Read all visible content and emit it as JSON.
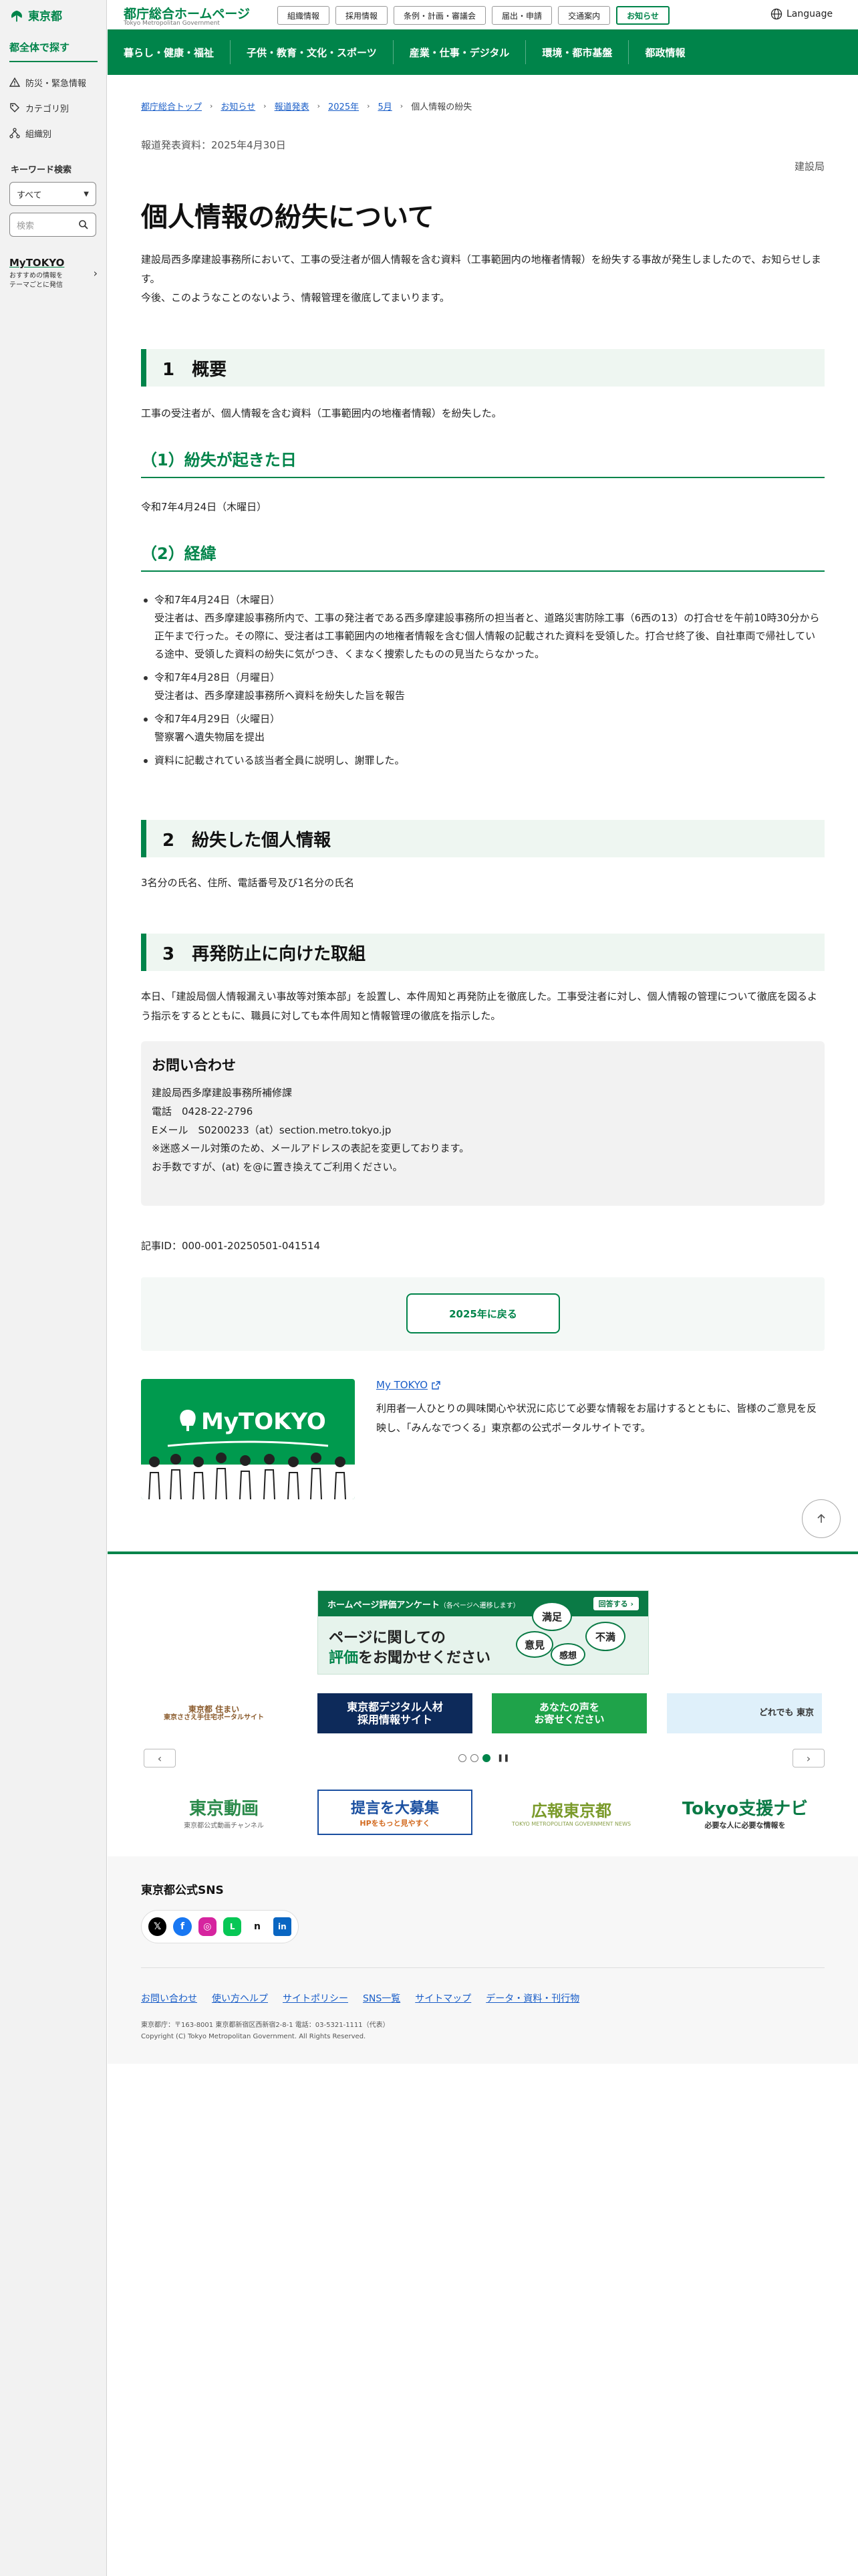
{
  "sidebar": {
    "logo_text": "東京都",
    "title": "都全体で探す",
    "items": [
      {
        "label": "防災・緊急情報",
        "icon": "warning-icon"
      },
      {
        "label": "カテゴリ別",
        "icon": "tag-icon"
      },
      {
        "label": "組織別",
        "icon": "org-chart-icon"
      }
    ],
    "keyword_title": "キーワード検索",
    "select_value": "すべて",
    "search_placeholder": "検索",
    "mytokyo": {
      "logo": "MyTOKYO",
      "desc": "おすすめの情報を\nテーマごとに発信"
    }
  },
  "header": {
    "site_name": "都庁総合ホームページ",
    "site_sub": "Tokyo Metropolitan Government",
    "links": [
      "組織情報",
      "採用情報",
      "条例・計画・審議会",
      "届出・申請",
      "交通案内",
      "お知らせ"
    ],
    "active_link": "お知らせ",
    "language": "Language"
  },
  "nav": [
    "暮らし・健康・福祉",
    "子供・教育・文化・スポーツ",
    "産業・仕事・デジタル",
    "環境・都市基盤",
    "都政情報"
  ],
  "breadcrumb": {
    "links": [
      "都庁総合トップ",
      "お知らせ",
      "報道発表",
      "2025年",
      "5月"
    ],
    "current": "個人情報の紛失"
  },
  "article": {
    "pubdate": "報道発表資料：2025年4月30日",
    "bureau": "建設局",
    "title": "個人情報の紛失について",
    "lead": [
      "建設局西多摩建設事務所において、工事の受注者が個人情報を含む資料（工事範囲内の地権者情報）を紛失する事故が発生しましたので、お知らせします。",
      "今後、このようなことのないよう、情報管理を徹底してまいります。"
    ],
    "sec1": {
      "heading": "1　概要",
      "body": "工事の受注者が、個人情報を含む資料（工事範囲内の地権者情報）を紛失した。",
      "sub1_heading": "（1）紛失が起きた日",
      "sub1_body": "令和7年4月24日（木曜日）",
      "sub2_heading": "（2）経緯",
      "events": [
        {
          "date": "令和7年4月24日（木曜日）",
          "detail": "受注者は、西多摩建設事務所内で、工事の発注者である西多摩建設事務所の担当者と、道路災害防除工事（6西の13）の打合せを午前10時30分から正午まで行った。その際に、受注者は工事範囲内の地権者情報を含む個人情報の記載された資料を受領した。打合せ終了後、自社車両で帰社している途中、受領した資料の紛失に気がつき、くまなく捜索したものの見当たらなかった。"
        },
        {
          "date": "令和7年4月28日（月曜日）",
          "detail": "受注者は、西多摩建設事務所へ資料を紛失した旨を報告"
        },
        {
          "date": "令和7年4月29日（火曜日）",
          "detail": "警察署へ遺失物届を提出"
        },
        {
          "date": "資料に記載されている該当者全員に説明し、謝罪した。",
          "detail": ""
        }
      ]
    },
    "sec2": {
      "heading": "2　紛失した個人情報",
      "body": "3名分の氏名、住所、電話番号及び1名分の氏名"
    },
    "sec3": {
      "heading": "3　再発防止に向けた取組",
      "body": "本日、「建設局個人情報漏えい事故等対策本部」を設置し、本件周知と再発防止を徹底した。工事受注者に対し、個人情報の管理について徹底を図るよう指示をするとともに、職員に対しても本件周知と情報管理の徹底を指示した。"
    },
    "contact": {
      "heading": "お問い合わせ",
      "lines": [
        "建設局西多摩建設事務所補修課",
        "電話　0428-22-2796",
        "Eメール　S0200233（at）section.metro.tokyo.jp",
        "※迷惑メール対策のため、メールアドレスの表記を変更しております。",
        "お手数ですが、(at) を@に置き換えてご利用ください。"
      ]
    },
    "article_id": "記事ID：000-001-20250501-041514",
    "back_label": "2025年に戻る"
  },
  "mytokyo_block": {
    "banner_title": "MyTOKYO",
    "link": "My TOKYO",
    "desc": "利用者一人ひとりの興味関心や状況に応じて必要な情報をお届けするとともに、皆様のご意見を反映し、「みんなでつくる」東京都の公式ポータルサイトです。"
  },
  "footer": {
    "survey": {
      "top": "ホームページ評価アンケート",
      "top_note": "（各ページへ遷移します）",
      "answer": "回答する",
      "main_line1": "ページに関しての",
      "main_line2_g": "評価",
      "main_line2_rest": "をお聞かせください",
      "bubbles": [
        "満足",
        "意見",
        "感想",
        "不満"
      ]
    },
    "carousel": [
      {
        "label": "東京都 住まい",
        "sub": "東京ささえ手住宅ポータルサイト",
        "bg": "#ffffff",
        "fg": "#8a5a2b"
      },
      {
        "label": "東京都デジタル人材",
        "sub": "採用情報サイト",
        "bg": "#0d2a5a",
        "fg": "#ffffff"
      },
      {
        "label": "あなたの声を",
        "sub": "お寄せください",
        "bg": "#1fa34a",
        "fg": "#ffffff"
      },
      {
        "label": "どれでも 東京",
        "sub": "",
        "bg": "#dff0fa",
        "fg": "#333333"
      }
    ],
    "partners": [
      {
        "label": "東京動画",
        "sub": "東京都公式動画チャンネル",
        "color": "#2a8a4a"
      },
      {
        "label": "提言を大募集",
        "sub": "HPをもっと見やすく",
        "color": "#1a4fa0"
      },
      {
        "label": "広報東京都",
        "sub": "TOKYO METROPOLITAN GOVERNMENT NEWS",
        "color": "#7a9a2a"
      },
      {
        "label": "Tokyo支援ナビ",
        "sub": "必要な人に必要な情報を",
        "color": "#0a7a45"
      }
    ],
    "sns_title": "東京都公式SNS",
    "sns": [
      {
        "icon": "x-icon",
        "bg": "#000000",
        "glyph": "𝕏"
      },
      {
        "icon": "facebook-icon",
        "bg": "#1877f2",
        "glyph": "f"
      },
      {
        "icon": "instagram-icon",
        "bg": "#d6249f",
        "glyph": "◎"
      },
      {
        "icon": "line-icon",
        "bg": "#06c755",
        "glyph": "L"
      },
      {
        "icon": "note-icon",
        "bg": "#ffffff",
        "glyph": "n"
      },
      {
        "icon": "linkedin-icon",
        "bg": "#0a66c2",
        "glyph": "in"
      }
    ],
    "links": [
      "お問い合わせ",
      "使い方ヘルプ",
      "サイトポリシー",
      "SNS一覧",
      "サイトマップ",
      "データ・資料・刊行物"
    ],
    "address": "東京都庁：〒163-8001 東京都新宿区西新宿2-8-1 電話：03-5321-1111（代表）",
    "copyright": "Copyright (C) Tokyo Metropolitan Government. All Rights Reserved."
  }
}
